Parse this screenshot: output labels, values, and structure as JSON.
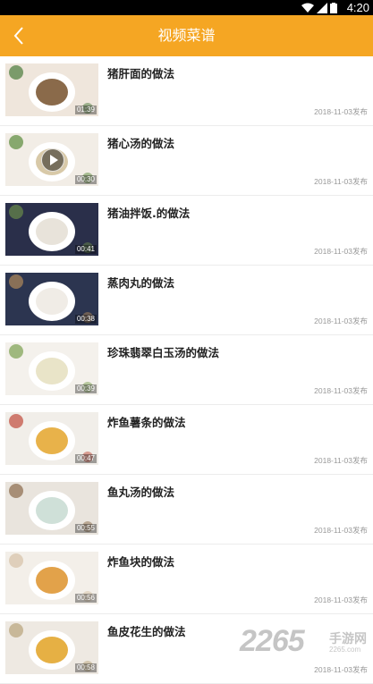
{
  "status_bar": {
    "time": "4:20"
  },
  "header": {
    "title": "视频菜谱"
  },
  "colors": {
    "accent": "#f5a623"
  },
  "list": [
    {
      "title": "猪肝面的做法",
      "duration": "01:39",
      "date": "2018-11-03发布",
      "play_overlay": false
    },
    {
      "title": "猪心汤的做法",
      "duration": "00:30",
      "date": "2018-11-03发布",
      "play_overlay": true
    },
    {
      "title": "猪油拌饭.的做法",
      "duration": "00:41",
      "date": "2018-11-03发布",
      "play_overlay": false
    },
    {
      "title": "蒸肉丸的做法",
      "duration": "00:38",
      "date": "2018-11-03发布",
      "play_overlay": false
    },
    {
      "title": "珍珠翡翠白玉汤的做法",
      "duration": "00:39",
      "date": "2018-11-03发布",
      "play_overlay": false
    },
    {
      "title": "炸鱼薯条的做法",
      "duration": "00:47",
      "date": "2018-11-03发布",
      "play_overlay": false
    },
    {
      "title": "鱼丸汤的做法",
      "duration": "00:55",
      "date": "2018-11-03发布",
      "play_overlay": false
    },
    {
      "title": "炸鱼块的做法",
      "duration": "00:56",
      "date": "2018-11-03发布",
      "play_overlay": false
    },
    {
      "title": "鱼皮花生的做法",
      "duration": "00:58",
      "date": "2018-11-03发布",
      "play_overlay": false
    }
  ],
  "watermark": {
    "number": "2265",
    "name": "手游网",
    "url": "2265.com"
  }
}
